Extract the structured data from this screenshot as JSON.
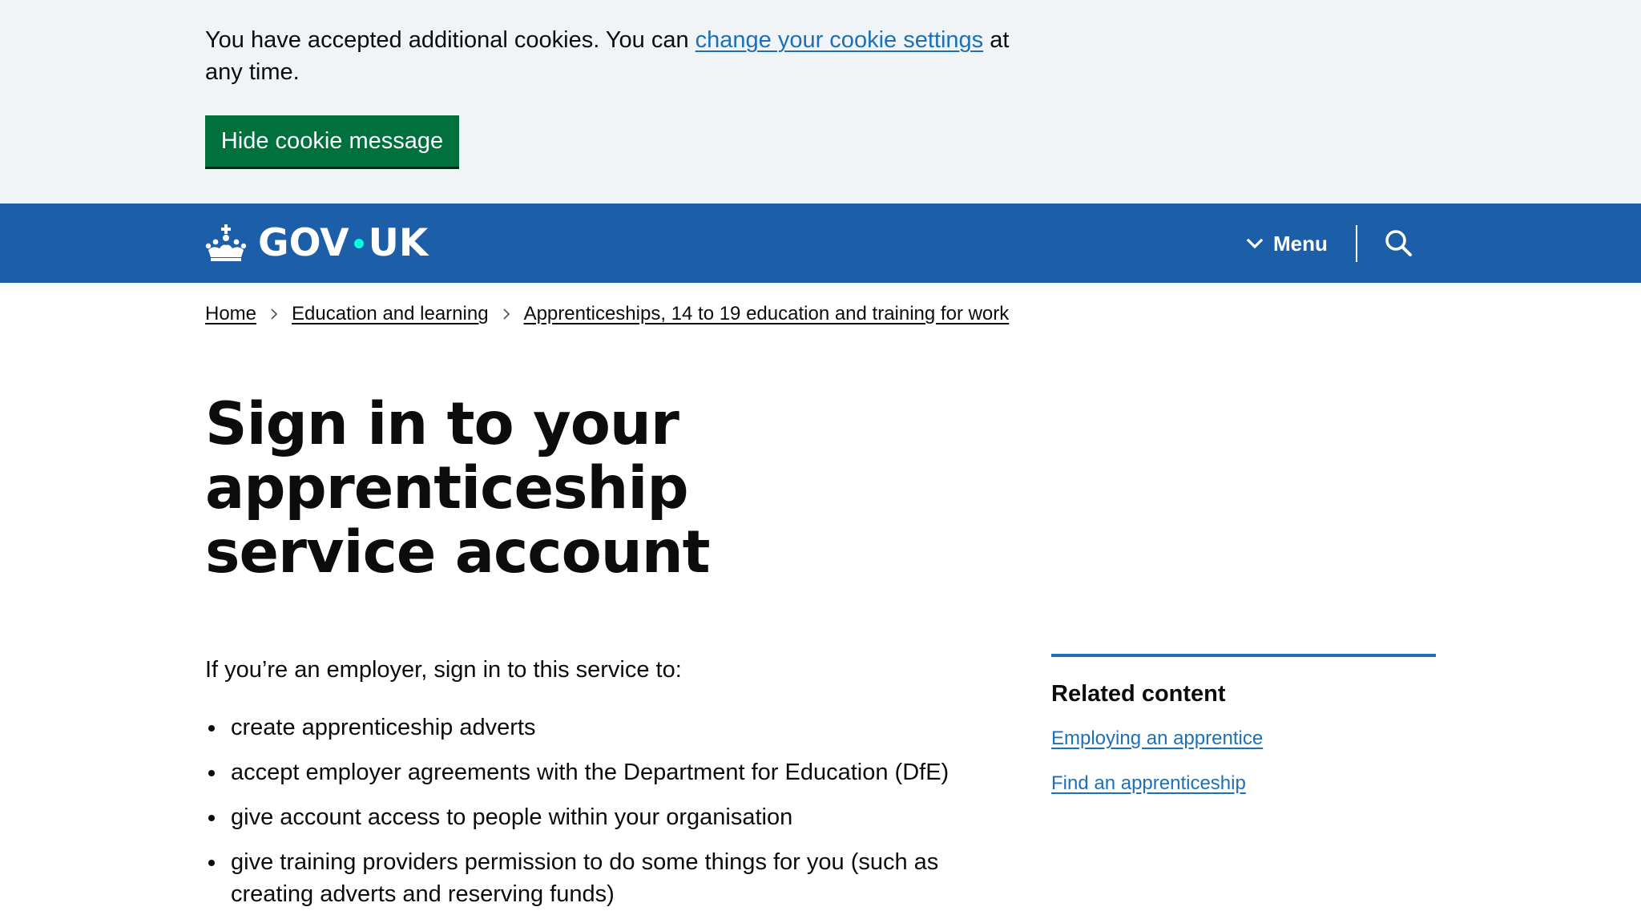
{
  "cookie_banner": {
    "text_before": "You have accepted additional cookies. You can ",
    "link_text": "change your cookie settings",
    "text_after": " at any time.",
    "hide_button_label": "Hide cookie message"
  },
  "header": {
    "logo_gov": "GOV",
    "logo_uk": "UK",
    "menu_label": "Menu",
    "colors": {
      "header_bg": "#1d5ea8",
      "logo_dot": "#00ffe0"
    }
  },
  "breadcrumbs": [
    {
      "label": "Home"
    },
    {
      "label": "Education and learning"
    },
    {
      "label": "Apprenticeships, 14 to 19 education and training for work"
    }
  ],
  "main": {
    "title": "Sign in to your apprenticeship service account",
    "intro": "If you’re an employer, sign in to this service to:",
    "bullets": [
      "create apprenticeship adverts",
      "accept employer agreements with the Department for Education (DfE)",
      "give account access to people within your organisation",
      "give training providers permission to do some things for you (such as creating adverts and reserving funds)"
    ]
  },
  "related": {
    "heading": "Related content",
    "links": [
      "Employing an apprentice",
      "Find an apprenticeship"
    ]
  },
  "icons": {
    "crown": "crown-icon",
    "menu": "chevron-down-icon",
    "search": "search-icon",
    "breadcrumb_separator": "chevron-right-icon"
  },
  "colors": {
    "cookie_bg": "#f0f4f7",
    "button_green": "#00703c",
    "link_blue": "#1d70b8",
    "text": "#0b0c0c"
  }
}
